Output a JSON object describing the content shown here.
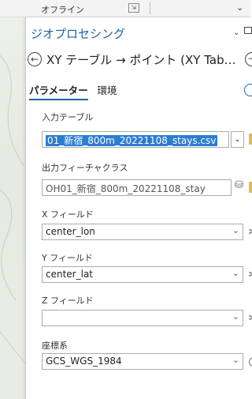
{
  "top_strip": {
    "status_text": "オフライン",
    "chevron": "⌄"
  },
  "pane": {
    "title": "ジオプロセシング",
    "title_chevron": "⌄",
    "tool_name": "XY テーブル → ポイント (XY Tab…",
    "back_glyph": "←",
    "forward_glyph": "→"
  },
  "tabs": [
    {
      "label": "パラメーター",
      "active": true
    },
    {
      "label": "環境",
      "active": false
    }
  ],
  "fields": {
    "input_table": {
      "label": "入力テーブル",
      "value": "01_新宿_800m_20221108_stays.csv"
    },
    "output_fc": {
      "label": "出力フィーチャクラス",
      "value": "OH01_新宿_800m_20221108_stay"
    },
    "x_field": {
      "label": "X フィールド",
      "value": "center_lon"
    },
    "y_field": {
      "label": "Y フィールド",
      "value": "center_lat"
    },
    "z_field": {
      "label": "Z フィールド",
      "value": ""
    },
    "coord_sys": {
      "label": "座標系",
      "value": "GCS_WGS_1984"
    }
  },
  "glyphs": {
    "dropdown": "⌄",
    "gear": "✲"
  },
  "colors": {
    "accent": "#1d63a8",
    "selection": "#2c7dd3",
    "folder": "#e6b94a"
  }
}
